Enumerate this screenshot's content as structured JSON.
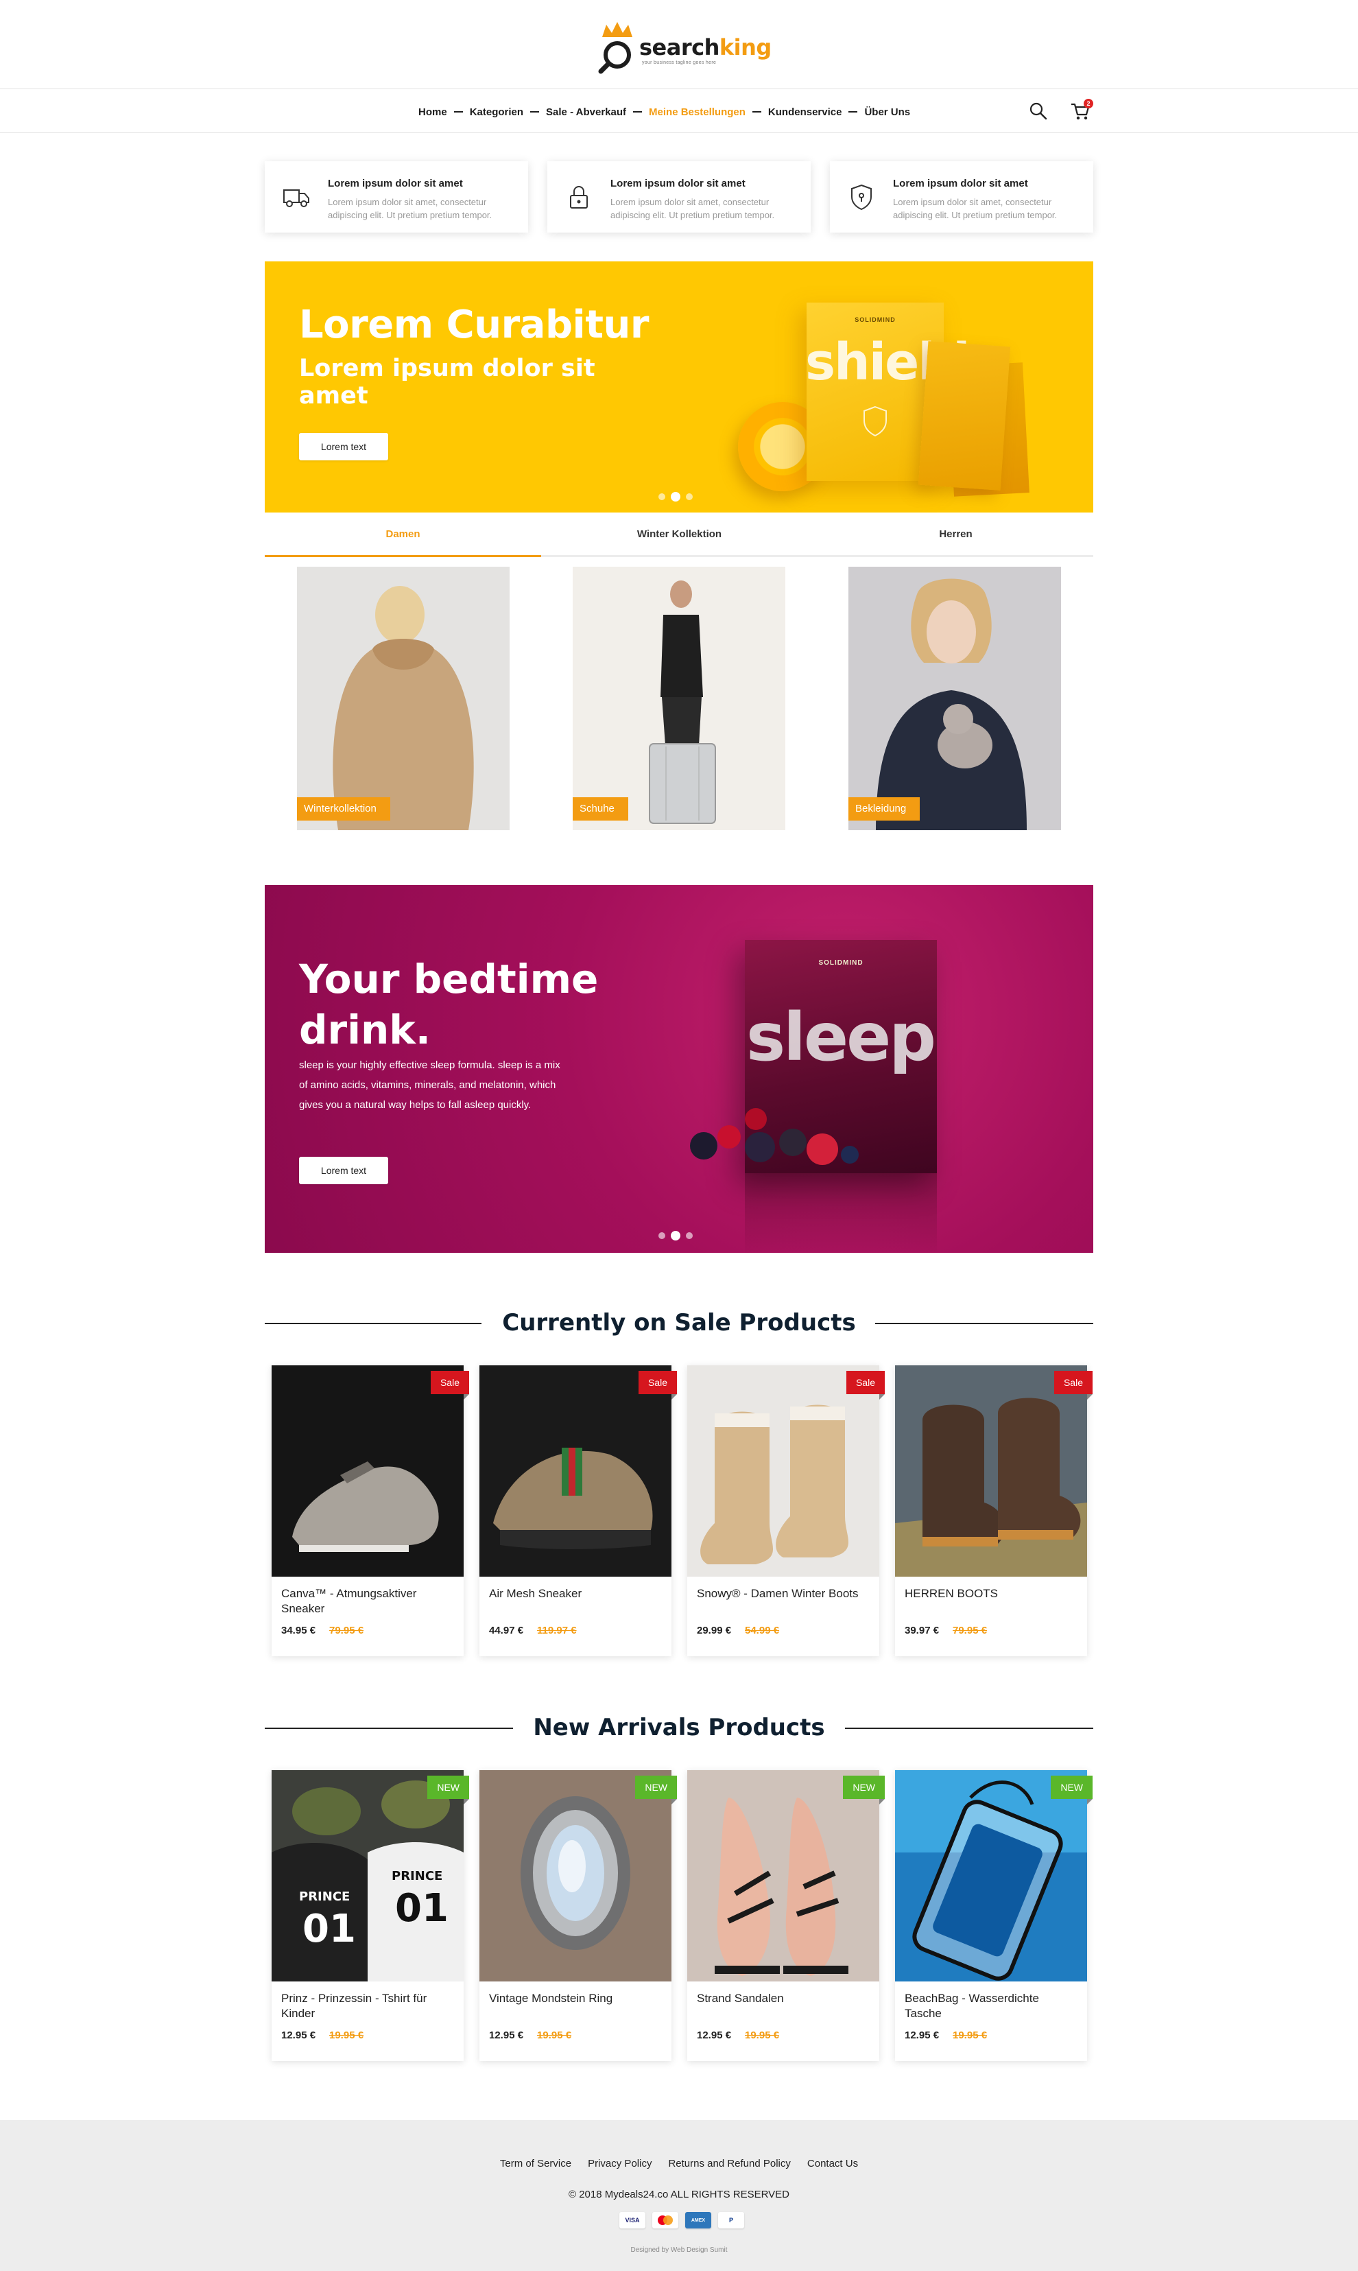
{
  "header": {
    "logo_text_1": "search",
    "logo_text_2": "king",
    "logo_tagline": "your business tagline goes here"
  },
  "nav": {
    "items": [
      "Home",
      "Kategorien",
      "Sale - Abverkauf",
      "Meine Bestellungen",
      "Kundenservice",
      "Über Uns"
    ],
    "active_index": 3,
    "cart_count": "2"
  },
  "features": [
    {
      "icon": "truck-icon",
      "title": "Lorem ipsum dolor sit amet",
      "desc": "Lorem ipsum dolor sit amet, consectetur adipiscing elit. Ut pretium pretium tempor."
    },
    {
      "icon": "lock-icon",
      "title": "Lorem ipsum dolor sit amet",
      "desc": "Lorem ipsum dolor sit amet, consectetur adipiscing elit. Ut pretium pretium tempor."
    },
    {
      "icon": "shield-icon",
      "title": "Lorem ipsum dolor sit amet",
      "desc": "Lorem ipsum dolor sit amet, consectetur adipiscing elit. Ut pretium pretium tempor."
    }
  ],
  "hero1": {
    "title": "Lorem Curabitur",
    "subtitle": "Lorem ipsum dolor sit amet",
    "button": "Lorem text",
    "product_brand": "SOLIDMIND",
    "product_word": "shield",
    "background": "#ffc802"
  },
  "tabs": [
    "Damen",
    "Winter Kollektion",
    "Herren"
  ],
  "categories": [
    "Winterkollektion",
    "Schuhe",
    "Bekleidung"
  ],
  "hero2": {
    "title": "Your bedtime drink.",
    "description": "sleep is your highly effective sleep formula. sleep is a mix of amino acids, vitamins, minerals, and melatonin, which gives you a natural way helps to fall asleep quickly.",
    "button": "Lorem text",
    "product_brand": "SOLIDMIND",
    "product_word": "sleep",
    "background": "#a40f5a"
  },
  "sale_section": {
    "title": "Currently on Sale Products",
    "badge": "Sale",
    "products": [
      {
        "name": "Canva™ - Atmungsaktiver Sneaker",
        "price": "34.95 €",
        "old_price": "79.95 €"
      },
      {
        "name": "Air Mesh Sneaker",
        "price": "44.97 €",
        "old_price": "119.97 €"
      },
      {
        "name": "Snowy® - Damen Winter Boots",
        "price": "29.99 €",
        "old_price": "54.99 €"
      },
      {
        "name": "HERREN BOOTS",
        "price": "39.97 €",
        "old_price": "79.95 €"
      }
    ]
  },
  "new_section": {
    "title": "New Arrivals Products",
    "badge": "NEW",
    "products": [
      {
        "name": "Prinz - Prinzessin - Tshirt für Kinder",
        "price": "12.95 €",
        "old_price": "19.95 €"
      },
      {
        "name": "Vintage Mondstein Ring",
        "price": "12.95 €",
        "old_price": "19.95 €"
      },
      {
        "name": "Strand Sandalen",
        "price": "12.95 €",
        "old_price": "19.95 €"
      },
      {
        "name": "BeachBag - Wasserdichte Tasche",
        "price": "12.95 €",
        "old_price": "19.95 €"
      }
    ]
  },
  "footer": {
    "links": [
      "Term of Service",
      "Privacy Policy",
      "Returns and Refund Policy",
      "Contact Us"
    ],
    "copyright": "© 2018 Mydeals24.co ALL RIGHTS RESERVED",
    "payments": [
      "VISA",
      "mastercard",
      "AMEX",
      "PayPal"
    ],
    "designed_by": "Designed by Web Design Sumit"
  },
  "colors": {
    "accent": "#f39c12",
    "sale": "#d6161e",
    "new": "#5ab72a"
  }
}
